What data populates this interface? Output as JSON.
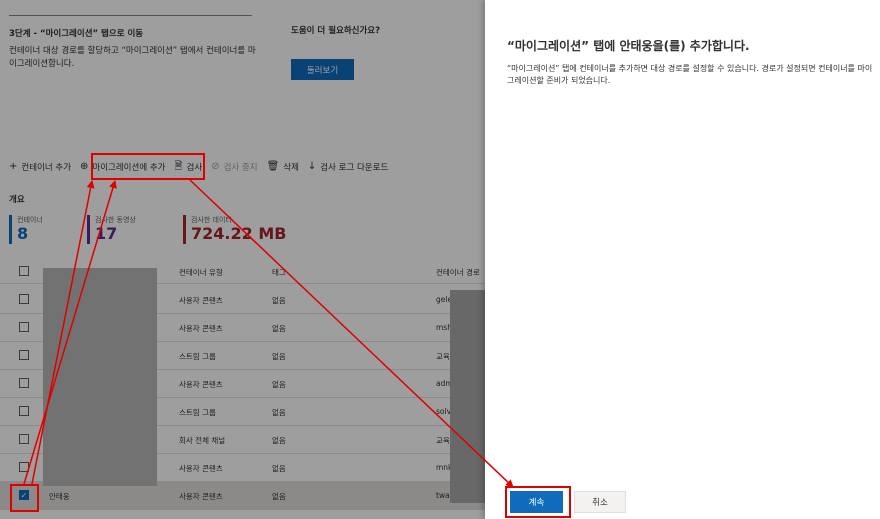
{
  "step": {
    "title": "3단계 - “마이그레이션” 탭으로 이동",
    "description": "컨테이너 대상 경로를 할당하고 “마이그레이션” 탭에서 컨테이너를 마이그레이션합니다."
  },
  "help": {
    "question": "도움이 더 필요하신가요?",
    "button_label": "둘러보기"
  },
  "toolbar": {
    "add_container": "컨테이너 추가",
    "add_to_migration": "마이그레이션에 추가",
    "scan": "검사",
    "stop_scan": "검사 중지",
    "delete": "삭제",
    "download_scan_log": "검사 로그 다운로드"
  },
  "overview": {
    "label": "개요",
    "metrics": [
      {
        "label": "컨테이너",
        "value": "8"
      },
      {
        "label": "검사한 동영상",
        "value": "17"
      },
      {
        "label": "검사한 데이터",
        "value": "724.22 MB"
      }
    ]
  },
  "table": {
    "columns": {
      "type": "컨테이너 유형",
      "tag": "태그",
      "path": "컨테이너 경로"
    },
    "rows": [
      {
        "name": "",
        "type": "사용자 콘텐츠",
        "tag": "없음",
        "path": "gele",
        "checked": false
      },
      {
        "name": "",
        "type": "사용자 콘텐츠",
        "tag": "없음",
        "path": "msh",
        "checked": false
      },
      {
        "name": "",
        "type": "스트림 그룹",
        "tag": "없음",
        "path": "교육",
        "checked": false
      },
      {
        "name": "",
        "type": "사용자 콘텐츠",
        "tag": "없음",
        "path": "adm",
        "checked": false
      },
      {
        "name": "",
        "type": "스트림 그룹",
        "tag": "없음",
        "path": "solv",
        "checked": false
      },
      {
        "name": "",
        "type": "회사 전체 채널",
        "tag": "없음",
        "path": "교육",
        "checked": false
      },
      {
        "name": "",
        "type": "사용자 콘텐츠",
        "tag": "없음",
        "path": "mnk",
        "checked": false
      },
      {
        "name": "안태웅",
        "type": "사용자 콘텐츠",
        "tag": "없음",
        "path": "twan",
        "checked": true
      }
    ]
  },
  "panel": {
    "title": "“마이그레이션” 탭에 안태웅을(를) 추가합니다.",
    "description": "“마이그레이션” 탭에 컨테이너를 추가하면 대상 경로를 설정할 수 있습니다. 경로가 설정되면 컨테이너를 마이그레이션할 준비가 되었습니다.",
    "continue_label": "계속",
    "cancel_label": "취소"
  },
  "colors": {
    "accent": "#0f6cbd",
    "metric_videos": "#5c2e91",
    "metric_data": "#a4262c",
    "annotation": "#e00000"
  }
}
